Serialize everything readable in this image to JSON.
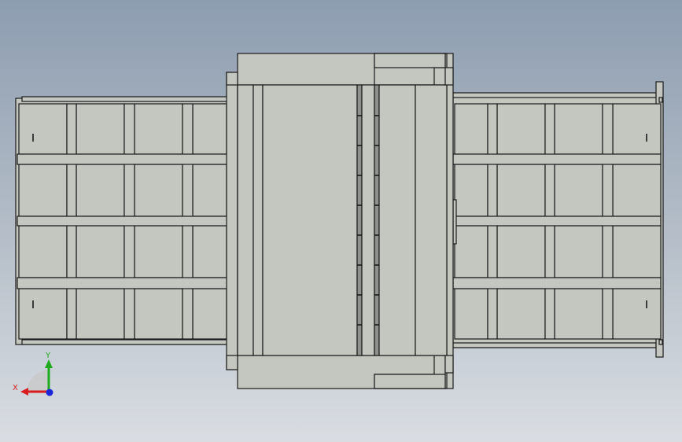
{
  "view": {
    "background_top": "#8d9db0",
    "background_bottom": "#d9dde2"
  },
  "model": {
    "face_color": "#c4c6c0",
    "edge_color": "#1a1a1a",
    "slot_color": "#8e918d"
  },
  "triad": {
    "x_label": "X",
    "y_label": "Y",
    "x_color": "#d81e1e",
    "y_color": "#1faa1f",
    "z_color": "#1c28d8"
  }
}
